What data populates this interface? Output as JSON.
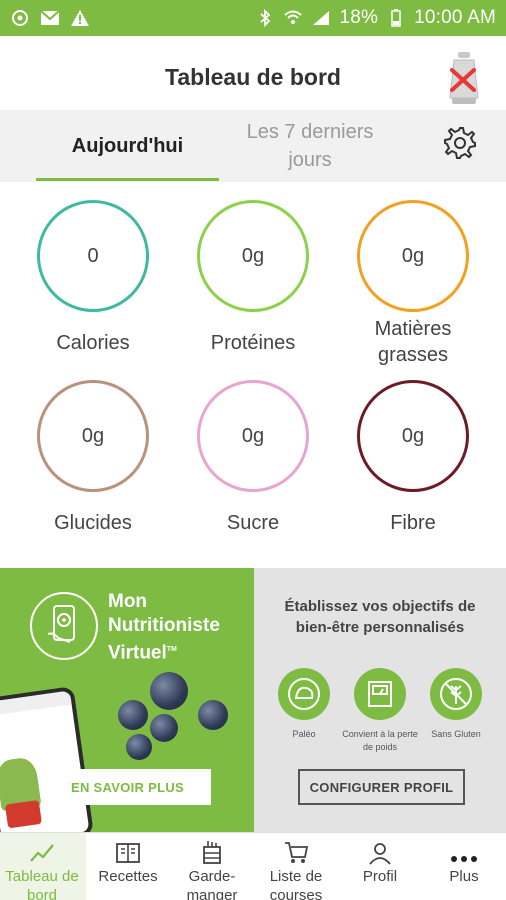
{
  "status_bar": {
    "battery": "18%",
    "time": "10:00 AM",
    "icons": [
      "sync-icon",
      "mail-icon",
      "warning-icon",
      "bluetooth-icon",
      "wifi-icon",
      "signal-icon",
      "battery-icon"
    ]
  },
  "header": {
    "title": "Tableau de bord",
    "scale_icon": "scale-disconnected-icon"
  },
  "tabs": {
    "today": "Aujourd'hui",
    "week": "Les 7 derniers jours",
    "settings_icon": "gear-icon"
  },
  "nutrients": [
    {
      "value": "0",
      "label": "Calories",
      "color": "#3fb9a3"
    },
    {
      "value": "0g",
      "label": "Protéines",
      "color": "#8cd14a"
    },
    {
      "value": "0g",
      "label": "Matières grasses",
      "color": "#f0a21f"
    },
    {
      "value": "0g",
      "label": "Glucides",
      "color": "#b9927d"
    },
    {
      "value": "0g",
      "label": "Sucre",
      "color": "#e7a5cf"
    },
    {
      "value": "0g",
      "label": "Fibre",
      "color": "#6e1b28"
    }
  ],
  "promo": {
    "title_line1": "Mon",
    "title_line2": "Nutritioniste",
    "title_line3": "Virtuel",
    "tm": "TM",
    "learn_more": "EN SAVOIR PLUS",
    "goal_title": "Établissez vos objectifs de bien-être personnalisés",
    "diets": [
      {
        "label": "Paléo",
        "icon": "paleo-icon"
      },
      {
        "label": "Convient à la perte de poids",
        "icon": "weight-loss-icon"
      },
      {
        "label": "Sans Gluten",
        "icon": "gluten-free-icon"
      }
    ],
    "configure": "CONFIGURER PROFIL",
    "accent": "#7dbb42"
  },
  "bottom_nav": [
    {
      "label": "Tableau de bord",
      "icon": "chart-line-icon",
      "active": true
    },
    {
      "label": "Recettes",
      "icon": "recipes-icon",
      "active": false
    },
    {
      "label": "Garde-manger",
      "icon": "pantry-icon",
      "active": false
    },
    {
      "label": "Liste de courses",
      "icon": "cart-icon",
      "active": false
    },
    {
      "label": "Profil",
      "icon": "user-icon",
      "active": false
    },
    {
      "label": "Plus",
      "icon": "more-icon",
      "active": false
    }
  ]
}
